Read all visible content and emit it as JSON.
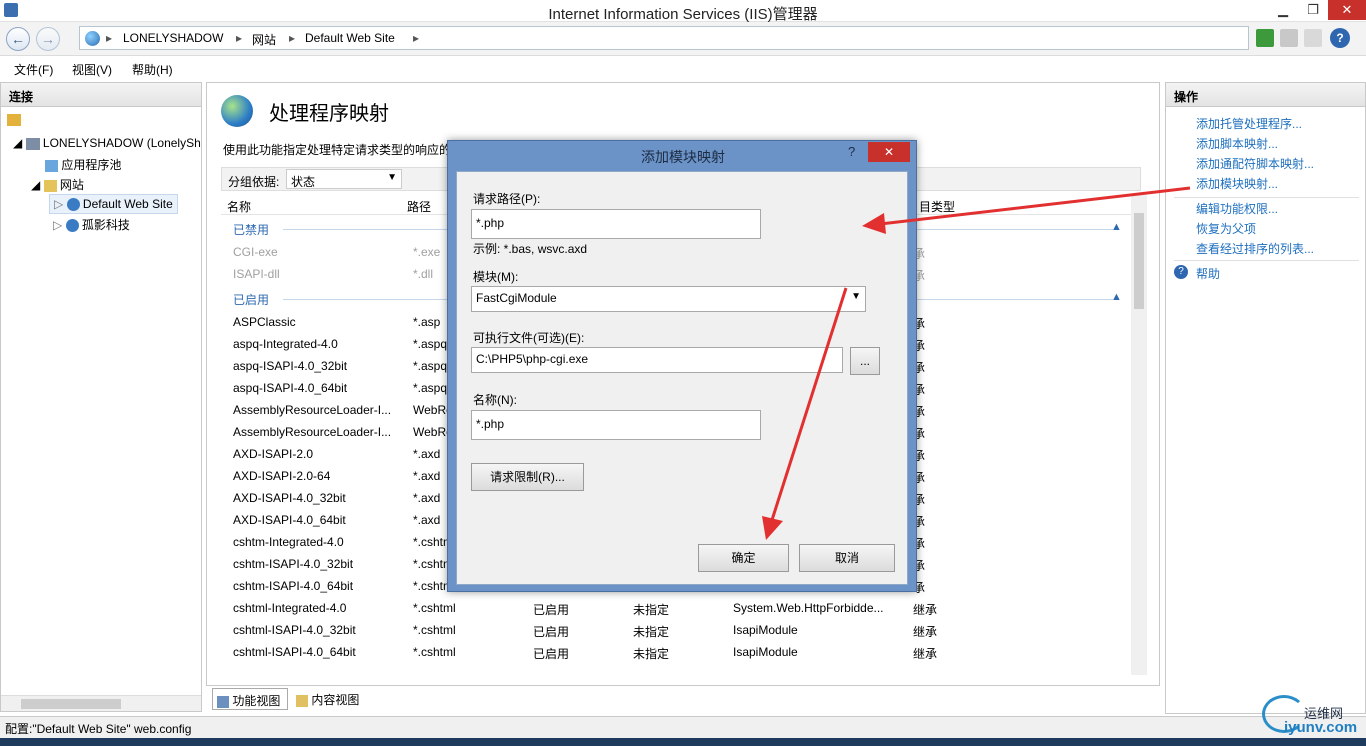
{
  "window": {
    "title": "Internet Information Services (IIS)管理器"
  },
  "address": {
    "crumbs": [
      "LONELYSHADOW",
      "网站",
      "Default Web Site"
    ]
  },
  "menu": [
    "文件(F)",
    "视图(V)",
    "帮助(H)"
  ],
  "left": {
    "header": "连接",
    "tree": [
      "LONELYSHADOW (LonelySh",
      "应用程序池",
      "网站",
      "Default Web Site",
      "孤影科技"
    ]
  },
  "center": {
    "title": "处理程序映射",
    "desc": "使用此功能指定处理特定请求类型的响应的",
    "group_label": "分组依据:",
    "group_value": "状态",
    "columns": [
      "名称",
      "路径",
      "目类型"
    ],
    "groups": [
      "已禁用",
      "已启用"
    ],
    "disabled_rows": [
      [
        "CGI-exe",
        "*.exe",
        "承"
      ],
      [
        "ISAPI-dll",
        "*.dll",
        "承"
      ]
    ],
    "rows": [
      [
        "ASPClassic",
        "*.asp",
        "",
        "",
        "",
        "承"
      ],
      [
        "aspq-Integrated-4.0",
        "*.aspq",
        "",
        "",
        "",
        "承"
      ],
      [
        "aspq-ISAPI-4.0_32bit",
        "*.aspq",
        "",
        "",
        "",
        "承"
      ],
      [
        "aspq-ISAPI-4.0_64bit",
        "*.aspq",
        "",
        "",
        "",
        "承"
      ],
      [
        "AssemblyResourceLoader-I...",
        "WebRe",
        "",
        "",
        "",
        "承"
      ],
      [
        "AssemblyResourceLoader-I...",
        "WebRe",
        "",
        "",
        "",
        "承"
      ],
      [
        "AXD-ISAPI-2.0",
        "*.axd",
        "",
        "",
        "",
        "承"
      ],
      [
        "AXD-ISAPI-2.0-64",
        "*.axd",
        "",
        "",
        "",
        "承"
      ],
      [
        "AXD-ISAPI-4.0_32bit",
        "*.axd",
        "",
        "",
        "",
        "承"
      ],
      [
        "AXD-ISAPI-4.0_64bit",
        "*.axd",
        "",
        "",
        "",
        "承"
      ],
      [
        "cshtm-Integrated-4.0",
        "*.cshtm",
        "",
        "",
        "",
        "承"
      ],
      [
        "cshtm-ISAPI-4.0_32bit",
        "*.cshtm",
        "",
        "",
        "",
        "承"
      ],
      [
        "cshtm-ISAPI-4.0_64bit",
        "*.cshtm",
        "",
        "",
        "",
        "承"
      ],
      [
        "cshtml-Integrated-4.0",
        "*.cshtml",
        "已启用",
        "未指定",
        "System.Web.HttpForbidde...",
        "继承"
      ],
      [
        "cshtml-ISAPI-4.0_32bit",
        "*.cshtml",
        "已启用",
        "未指定",
        "IsapiModule",
        "继承"
      ],
      [
        "cshtml-ISAPI-4.0_64bit",
        "*.cshtml",
        "已启用",
        "未指定",
        "IsapiModule",
        "继承"
      ]
    ],
    "tabs": [
      "功能视图",
      "内容视图"
    ]
  },
  "right": {
    "header": "操作",
    "actions": [
      "添加托管处理程序...",
      "添加脚本映射...",
      "添加通配符脚本映射...",
      "添加模块映射...",
      "编辑功能权限...",
      "恢复为父项",
      "查看经过排序的列表...",
      "帮助"
    ]
  },
  "dialog": {
    "title": "添加模块映射",
    "help": "?",
    "close": "✕",
    "path_label": "请求路径(P):",
    "path_value": "*.php",
    "path_example": "示例: *.bas, wsvc.axd",
    "module_label": "模块(M):",
    "module_value": "FastCgiModule",
    "exe_label": "可执行文件(可选)(E):",
    "exe_value": "C:\\PHP5\\php-cgi.exe",
    "browse": "...",
    "name_label": "名称(N):",
    "name_value": "*.php",
    "restrict": "请求限制(R)...",
    "ok": "确定",
    "cancel": "取消"
  },
  "status": "配置:\"Default Web Site\" web.config",
  "watermark": [
    "运维网",
    "iyunv.com"
  ]
}
